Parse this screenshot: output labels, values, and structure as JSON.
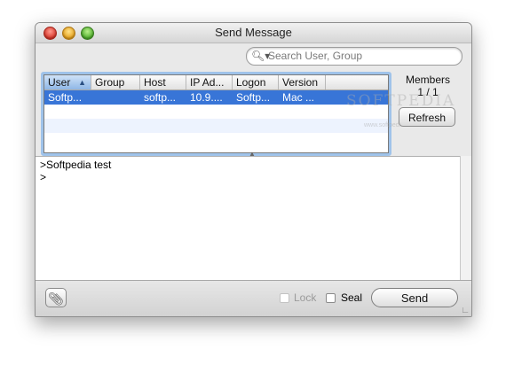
{
  "window": {
    "title": "Send Message"
  },
  "search": {
    "placeholder": "Search User, Group"
  },
  "table": {
    "columns": [
      "User",
      "Group",
      "Host",
      "IP Ad...",
      "Logon",
      "Version"
    ],
    "sort_column": "User",
    "sort_direction": "ascending",
    "rows": [
      {
        "user": "Softp...",
        "group": "",
        "host": "softp...",
        "ip": "10.9....",
        "logon": "Softp...",
        "version": "Mac ..."
      }
    ]
  },
  "members": {
    "label": "Members",
    "count": "1 / 1"
  },
  "refresh_label": "Refresh",
  "message": {
    "lines": [
      ">Softpedia test",
      ">"
    ]
  },
  "options": {
    "lock_label": "Lock",
    "lock_enabled": false,
    "seal_label": "Seal",
    "seal_checked": false
  },
  "send_label": "Send",
  "watermark": {
    "text": "SOFTPEDIA",
    "sub": "www.softpedia.com"
  },
  "icons": {
    "search": "magnifier-icon",
    "attach": "paperclip-icon",
    "resize": "resize-grip-icon"
  },
  "colors": {
    "selection": "#3875d7",
    "focus_ring": "#9fc3ea"
  }
}
